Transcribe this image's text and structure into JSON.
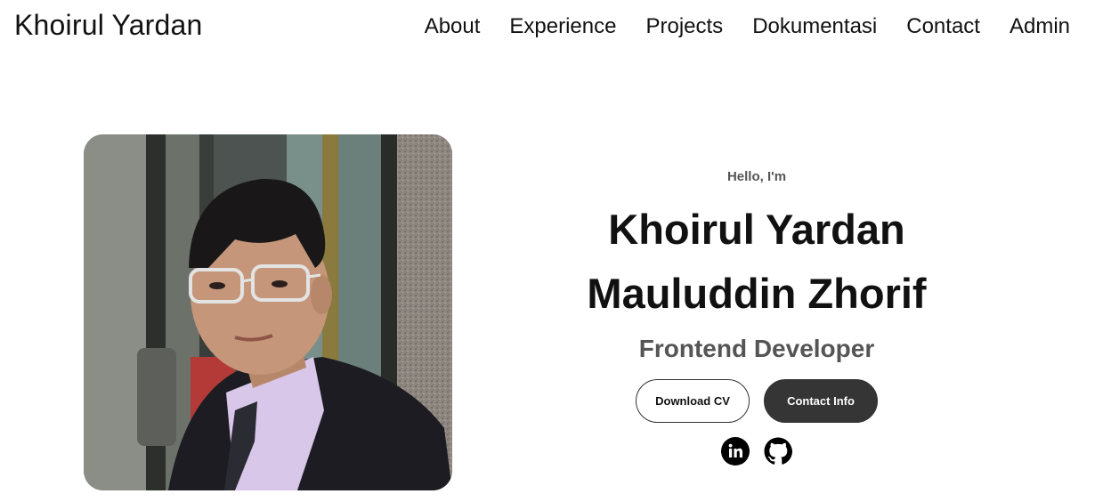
{
  "nav": {
    "logo": "Khoirul Yardan",
    "links": [
      {
        "label": "About"
      },
      {
        "label": "Experience"
      },
      {
        "label": "Projects"
      },
      {
        "label": "Dokumentasi"
      },
      {
        "label": "Contact"
      },
      {
        "label": "Admin"
      }
    ]
  },
  "hero": {
    "greeting": "Hello, I'm",
    "name_line1": "Khoirul Yardan",
    "name_line2": "Mauluddin Zhorif",
    "role": "Frontend Developer",
    "buttons": {
      "download_cv": "Download CV",
      "contact_info": "Contact Info"
    },
    "socials": [
      {
        "icon": "linkedin-icon"
      },
      {
        "icon": "github-icon"
      }
    ]
  },
  "colors": {
    "text": "#111111",
    "muted": "#555555",
    "button_dark": "#353535",
    "background": "#ffffff"
  }
}
